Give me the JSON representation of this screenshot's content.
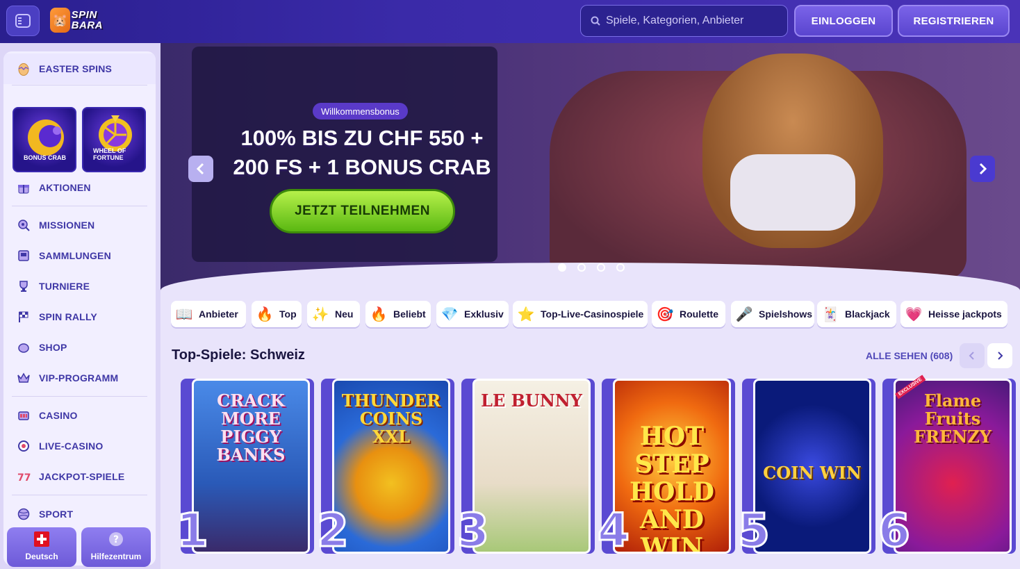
{
  "header": {
    "logo_text": "SPIN BARA",
    "search_placeholder": "Spiele, Kategorien, Anbieter",
    "login_label": "EINLOGGEN",
    "register_label": "REGISTRIEREN"
  },
  "sidebar": {
    "top_item": "EASTER SPINS",
    "feature_cards": [
      {
        "label": "BONUS CRAB"
      },
      {
        "label": "WHEEL OF FORTUNE"
      }
    ],
    "items": [
      {
        "label": "AKTIONEN",
        "icon": "gift-icon"
      },
      {
        "label": "MISSIONEN",
        "icon": "target-icon"
      },
      {
        "label": "SAMMLUNGEN",
        "icon": "album-icon"
      },
      {
        "label": "TURNIERE",
        "icon": "trophy-icon"
      },
      {
        "label": "SPIN RALLY",
        "icon": "race-flag-icon"
      },
      {
        "label": "SHOP",
        "icon": "shop-icon"
      },
      {
        "label": "VIP-PROGRAMM",
        "icon": "crown-icon"
      },
      {
        "label": "CASINO",
        "icon": "slot-icon"
      },
      {
        "label": "LIVE-CASINO",
        "icon": "chip-icon"
      },
      {
        "label": "JACKPOT-SPIELE",
        "icon": "jackpot-icon"
      },
      {
        "label": "SPORT",
        "icon": "ball-icon"
      }
    ],
    "language_label": "Deutsch",
    "help_label": "Hilfezentrum"
  },
  "hero": {
    "badge": "Willkommensbonus",
    "title_line1": "100% BIS ZU CHF 550 +",
    "title_line2": "200 FS + 1 BONUS CRAB",
    "cta": "JETZT TEILNEHMEN",
    "slides_total": 4,
    "active_slide": 1
  },
  "categories": [
    {
      "label": "Anbieter",
      "icon": "book-icon",
      "glyph": "📖"
    },
    {
      "label": "Top",
      "icon": "top-icon",
      "glyph": "🔥"
    },
    {
      "label": "Neu",
      "icon": "new-icon",
      "glyph": "✨"
    },
    {
      "label": "Beliebt",
      "icon": "fire-icon",
      "glyph": "🔥"
    },
    {
      "label": "Exklusiv",
      "icon": "gem-icon",
      "glyph": "💎"
    },
    {
      "label": "Top-Live-Casinospiele",
      "icon": "star-icon",
      "glyph": "⭐"
    },
    {
      "label": "Roulette",
      "icon": "roulette-icon",
      "glyph": "🎯"
    },
    {
      "label": "Spielshows",
      "icon": "show-icon",
      "glyph": "🎤"
    },
    {
      "label": "Blackjack",
      "icon": "cards-icon",
      "glyph": "🃏"
    },
    {
      "label": "Heisse jackpots",
      "icon": "heart-icon",
      "glyph": "💗"
    }
  ],
  "section": {
    "title": "Top-Spiele: Schweiz",
    "see_all": "ALLE SEHEN (608)"
  },
  "games": [
    {
      "rank": "1",
      "name": "CRACK MORE PIGGY BANKS",
      "color": "#3a7ad8"
    },
    {
      "rank": "2",
      "name": "THUNDER COINS XXL",
      "color": "#1a6ad8"
    },
    {
      "rank": "3",
      "name": "LE BUNNY",
      "color": "#f0e8d8"
    },
    {
      "rank": "4",
      "name": "HOT STEP HOLD AND WIN",
      "color": "#e84a10"
    },
    {
      "rank": "5",
      "name": "COIN WIN",
      "color": "#0a1a7a"
    },
    {
      "rank": "6",
      "name": "Flame Fruits FRENZY",
      "color": "#6a1a8a",
      "exclusive": "EXCLUSIVE"
    }
  ],
  "colors": {
    "accent": "#3f37a6",
    "cta_green": "#5ab812",
    "header_bg": "#2a1f8f"
  }
}
